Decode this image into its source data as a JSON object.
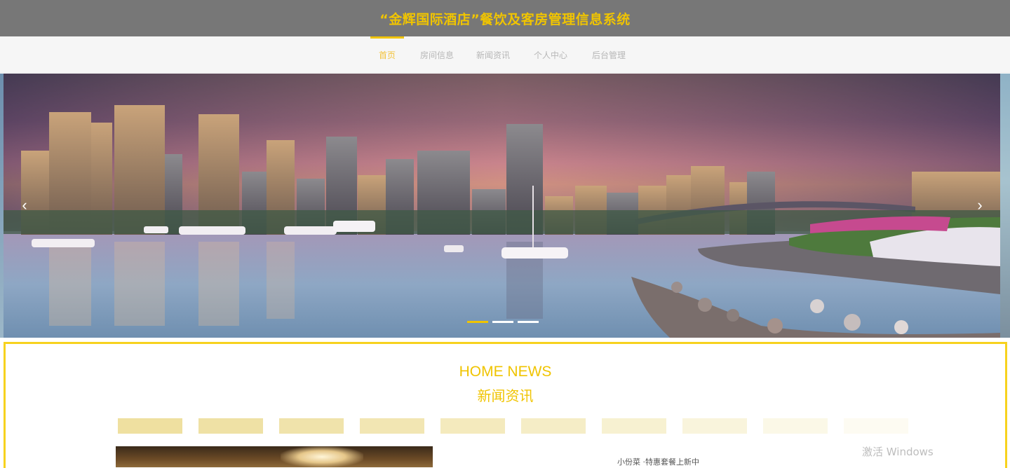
{
  "header": {
    "title": "“金辉国际酒店”餐饮及客房管理信息系统"
  },
  "nav": {
    "items": [
      {
        "label": "首页",
        "active": true
      },
      {
        "label": "房间信息",
        "active": false
      },
      {
        "label": "新闻资讯",
        "active": false
      },
      {
        "label": "个人中心",
        "active": false
      },
      {
        "label": "后台管理",
        "active": false
      }
    ]
  },
  "banner": {
    "prev_icon": "chevron-left-icon",
    "next_icon": "chevron-right-icon",
    "prev_glyph": "‹",
    "next_glyph": "›",
    "slide_count": 3,
    "active_slide": 1
  },
  "news": {
    "title_en": "HOME NEWS",
    "title_cn": "新闻资讯",
    "tab_count": 10,
    "headline": "小份菜 ·特惠套餐上新中"
  },
  "watermark": "激活 Windows",
  "colors": {
    "accent": "#f0c400",
    "header_bg": "#777777",
    "nav_inactive": "#b7b7b7"
  }
}
